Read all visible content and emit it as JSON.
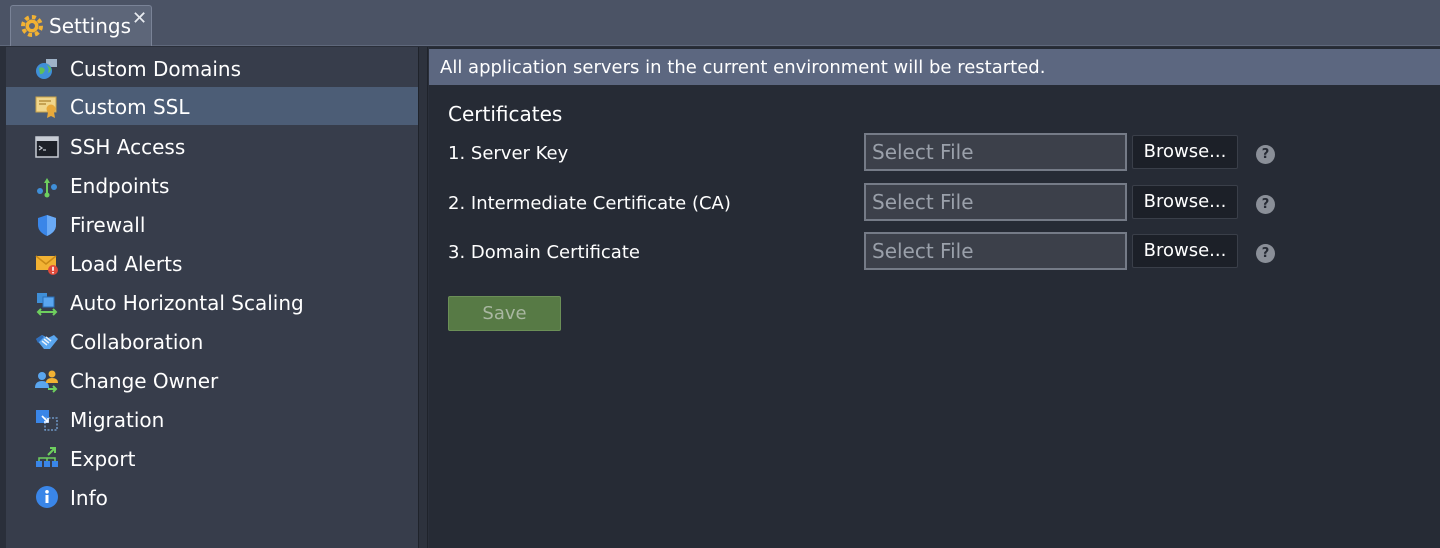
{
  "tab": {
    "title": "Settings",
    "close_glyph": "✕",
    "icon": "settings-gear-icon"
  },
  "sidebar": {
    "items": [
      {
        "label": "Custom Domains",
        "icon": "globe-icon"
      },
      {
        "label": "Custom SSL",
        "icon": "certificate-icon",
        "selected": true
      },
      {
        "label": "SSH Access",
        "icon": "terminal-icon"
      },
      {
        "label": "Endpoints",
        "icon": "endpoints-icon"
      },
      {
        "label": "Firewall",
        "icon": "shield-icon"
      },
      {
        "label": "Load Alerts",
        "icon": "alert-mail-icon"
      },
      {
        "label": "Auto Horizontal Scaling",
        "icon": "scaling-icon"
      },
      {
        "label": "Collaboration",
        "icon": "handshake-icon"
      },
      {
        "label": "Change Owner",
        "icon": "change-owner-icon"
      },
      {
        "label": "Migration",
        "icon": "migration-icon"
      },
      {
        "label": "Export",
        "icon": "export-icon"
      },
      {
        "label": "Info",
        "icon": "info-icon"
      }
    ]
  },
  "main": {
    "notice": "All application servers in the current environment will be restarted.",
    "section_title": "Certificates",
    "fields": [
      {
        "label": "1. Server Key",
        "placeholder": "Select File",
        "browse_label": "Browse...",
        "help": "?"
      },
      {
        "label": "2. Intermediate Certificate (CA)",
        "placeholder": "Select File",
        "browse_label": "Browse...",
        "help": "?"
      },
      {
        "label": "3. Domain Certificate",
        "placeholder": "Select File",
        "browse_label": "Browse...",
        "help": "?"
      }
    ],
    "save_label": "Save"
  },
  "colors": {
    "selected_item": "#4c5d76",
    "notice_bar": "#5c6780",
    "save_button": "#577a45"
  }
}
